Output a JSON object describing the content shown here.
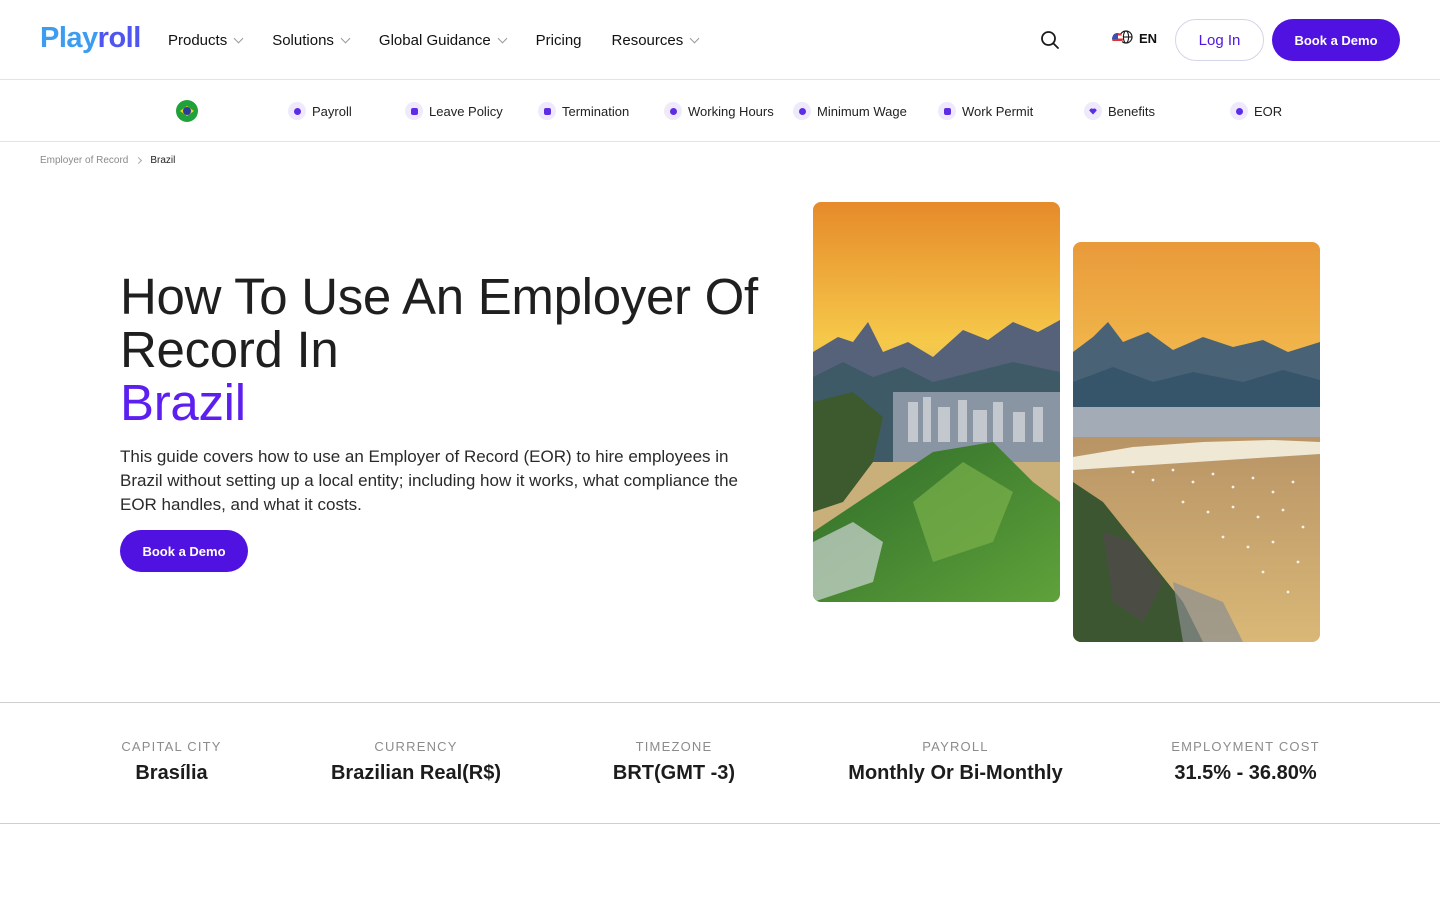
{
  "brand": {
    "logo_part1": "Play",
    "logo_part2": "roll"
  },
  "nav": {
    "items": [
      {
        "label": "Products",
        "has_dropdown": true
      },
      {
        "label": "Solutions",
        "has_dropdown": true
      },
      {
        "label": "Global Guidance",
        "has_dropdown": true
      },
      {
        "label": "Pricing",
        "has_dropdown": false
      },
      {
        "label": "Resources",
        "has_dropdown": true
      }
    ],
    "language": "EN",
    "login_label": "Log In",
    "demo_label": "Book a Demo"
  },
  "subnav": {
    "country_flag_icon": "brazil-flag-icon",
    "items": [
      {
        "label": "Payroll",
        "icon": "payroll-icon"
      },
      {
        "label": "Leave Policy",
        "icon": "calendar-icon"
      },
      {
        "label": "Termination",
        "icon": "termination-icon"
      },
      {
        "label": "Working Hours",
        "icon": "clock-icon"
      },
      {
        "label": "Minimum Wage",
        "icon": "wage-icon"
      },
      {
        "label": "Work Permit",
        "icon": "permit-icon"
      },
      {
        "label": "Benefits",
        "icon": "heart-icon"
      },
      {
        "label": "EOR",
        "icon": "location-icon"
      }
    ]
  },
  "breadcrumb": {
    "parent": "Employer of Record",
    "current": "Brazil"
  },
  "hero": {
    "title_line": "How To Use An Employer Of Record In",
    "title_country": "Brazil",
    "description": "This guide covers how to use an Employer of Record (EOR) to hire employees in Brazil without setting up a local entity; including how it works, what compliance the EOR handles, and what it costs.",
    "cta_label": "Book a Demo"
  },
  "facts": [
    {
      "label": "Capital City",
      "value": "Brasília"
    },
    {
      "label": "Currency",
      "value": "Brazilian Real(R$)"
    },
    {
      "label": "Timezone",
      "value": "BRT(GMT -3)"
    },
    {
      "label": "Payroll",
      "value": "Monthly Or Bi-Monthly"
    },
    {
      "label": "Employment Cost",
      "value": "31.5% - 36.80%"
    }
  ],
  "colors": {
    "accent": "#5012e0",
    "accent_text": "#5d1ff0",
    "logo_blue": "#3b9cf0",
    "logo_indigo": "#4f55f0"
  }
}
